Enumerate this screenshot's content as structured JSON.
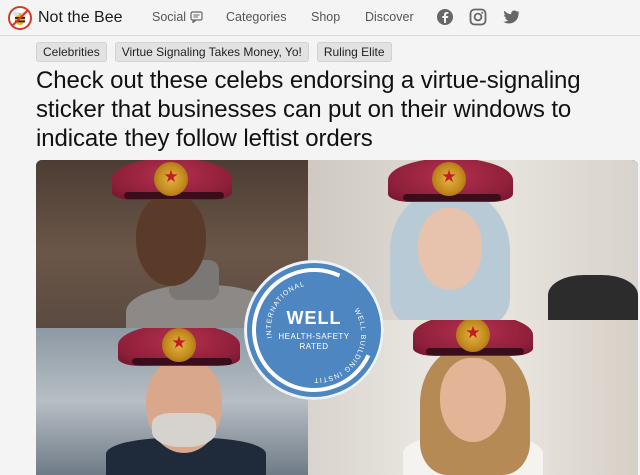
{
  "header": {
    "site_name": "Not the Bee",
    "nav": [
      {
        "label": "Social"
      },
      {
        "label": "Categories"
      },
      {
        "label": "Shop"
      },
      {
        "label": "Discover"
      }
    ],
    "social_icons": [
      "facebook-icon",
      "instagram-icon",
      "twitter-icon"
    ]
  },
  "tags": [
    "Celebrities",
    "Virtue Signaling Takes Money, Yo!",
    "Ruling Elite"
  ],
  "article": {
    "headline": "Check out these celebs endorsing a virtue-signaling sticker that businesses can put on their windows to indicate they follow leftist orders"
  },
  "seal": {
    "title": "WELL",
    "subtitle": "HEALTH-SAFETY RATED",
    "arc_top": "INTERNATIONAL",
    "arc_right": "WELL BUILDING INSTITUTE"
  },
  "colors": {
    "beret": "#8e1f3a",
    "seal": "#4d86c0",
    "background": "#f4f4f4"
  }
}
